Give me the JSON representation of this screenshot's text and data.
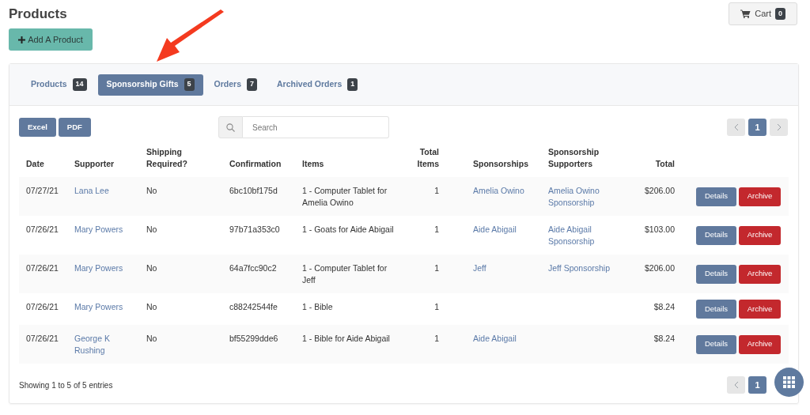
{
  "page_title": "Products",
  "cart": {
    "label": "Cart",
    "count": "0"
  },
  "add_button": {
    "label": "Add A Product"
  },
  "tabs": [
    {
      "label": "Products",
      "count": "14",
      "selected": false
    },
    {
      "label": "Sponsorship Gifts",
      "count": "5",
      "selected": true
    },
    {
      "label": "Orders",
      "count": "7",
      "selected": false
    },
    {
      "label": "Archived Orders",
      "count": "1",
      "selected": false
    }
  ],
  "export_buttons": [
    "Excel",
    "PDF"
  ],
  "search": {
    "placeholder": "Search"
  },
  "pagination_top": {
    "prev_disabled": true,
    "next_disabled": true,
    "pages": [
      {
        "label": "1",
        "selected": true
      }
    ]
  },
  "table": {
    "columns": [
      "Date",
      "Supporter",
      "Shipping Required?",
      "Confirmation",
      "Items",
      "Total Items",
      "Sponsorships",
      "Sponsorship Supporters",
      "Total"
    ],
    "rows": [
      {
        "date": "07/27/21",
        "supporter": "Lana Lee",
        "shipping_required": "No",
        "confirmation": "6bc10bf175d",
        "items": "1 - Computer Tablet for Amelia Owino",
        "total_items": "1",
        "sponsorships": "Amelia Owino",
        "sponsorship_supporters": "Amelia Owino Sponsorship",
        "total": "$206.00",
        "actions": [
          "Details",
          "Archive"
        ]
      },
      {
        "date": "07/26/21",
        "supporter": "Mary Powers",
        "shipping_required": "No",
        "confirmation": "97b71a353c0",
        "items": "1 - Goats for Aide Abigail",
        "total_items": "1",
        "sponsorships": "Aide Abigail",
        "sponsorship_supporters": "Aide Abigail Sponsorship",
        "total": "$103.00",
        "actions": [
          "Details",
          "Archive"
        ]
      },
      {
        "date": "07/26/21",
        "supporter": "Mary Powers",
        "shipping_required": "No",
        "confirmation": "64a7fcc90c2",
        "items": "1 - Computer Tablet for Jeff",
        "total_items": "1",
        "sponsorships": "Jeff",
        "sponsorship_supporters": "Jeff Sponsorship",
        "total": "$206.00",
        "actions": [
          "Details",
          "Archive"
        ]
      },
      {
        "date": "07/26/21",
        "supporter": "Mary Powers",
        "shipping_required": "No",
        "confirmation": "c88242544fe",
        "items": "1 - Bible",
        "total_items": "1",
        "total": "$8.24",
        "actions": [
          "Details",
          "Archive"
        ]
      },
      {
        "date": "07/26/21",
        "supporter": "George K Rushing",
        "shipping_required": "No",
        "confirmation": "bf55299dde6",
        "items": "1 - Bible for Aide Abigail",
        "total_items": "1",
        "sponsorships": "Aide Abigail",
        "total": "$8.24",
        "actions": [
          "Details",
          "Archive"
        ]
      }
    ]
  },
  "info": "Showing 1 to 5 of 5 entries",
  "pagination_bottom": {
    "prev_disabled": true,
    "pages": [
      {
        "label": "1",
        "selected": true
      }
    ]
  }
}
